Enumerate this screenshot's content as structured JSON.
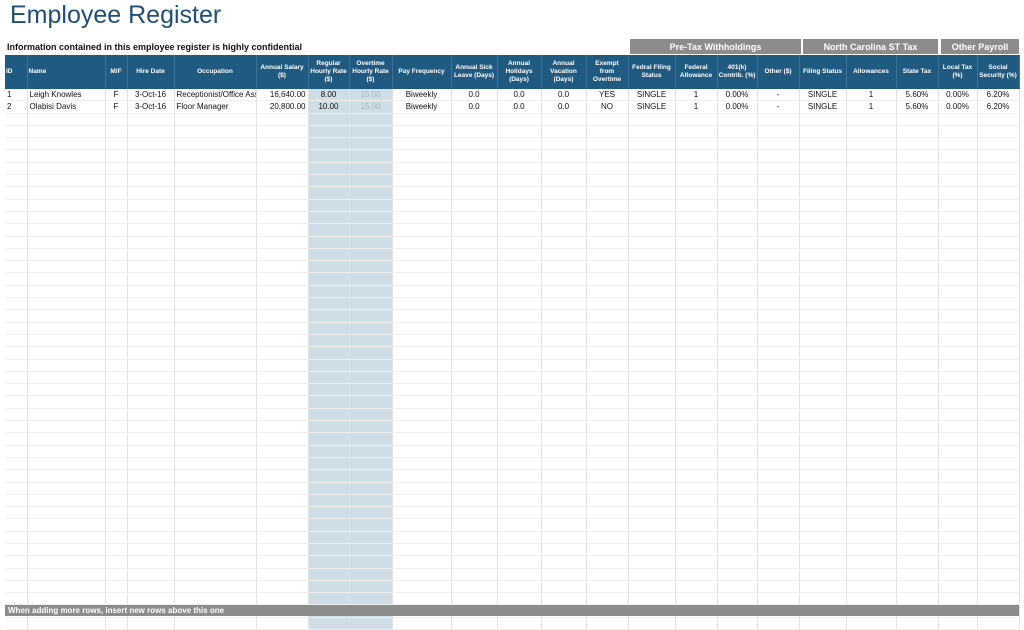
{
  "title": "Employee Register",
  "notice": "Information contained in this employee register is highly confidential",
  "groups": {
    "pretax": "Pre-Tax Withholdings",
    "nc_tax": "North Carolina ST Tax",
    "other": "Other Payroll"
  },
  "headers": [
    "ID",
    "Name",
    "M/F",
    "Hire Date",
    "Occupation",
    "Annual Salary ($)",
    "Regular Hourly Rate ($)",
    "Overtime Hourly Rate ($)",
    "Pay Frequency",
    "Annual Sick Leave (Days)",
    "Annual Holidays (Days)",
    "Annual Vacation (Days)",
    "Exempt from Overtime",
    "Fedral Filing Status",
    "Federal Allowance",
    "401(k) Contrib. (%)",
    "Other ($)",
    "Filing Status",
    "Allowances",
    "State Tax",
    "Local Tax (%)",
    "Social Security (%)"
  ],
  "rows": [
    [
      "1",
      "Leigh Knowles",
      "F",
      "3-Oct-16",
      "Receptionist/Office Assistant",
      "16,640.00",
      "8.00",
      "15.00",
      "Biweekly",
      "0.0",
      "0.0",
      "0.0",
      "YES",
      "SINGLE",
      "1",
      "0.00%",
      "-",
      "SINGLE",
      "1",
      "5.60%",
      "0.00%",
      "6.20%"
    ],
    [
      "2",
      "Olabisi Davis",
      "F",
      "3-Oct-16",
      "Floor Manager",
      "20,800.00",
      "10.00",
      "15.00",
      "Biweekly",
      "0.0",
      "0.0",
      "0.0",
      "NO",
      "SINGLE",
      "1",
      "0.00%",
      "-",
      "SINGLE",
      "1",
      "5.60%",
      "0.00%",
      "6.20%"
    ]
  ],
  "footer": "When adding more rows, insert new rows above this one"
}
